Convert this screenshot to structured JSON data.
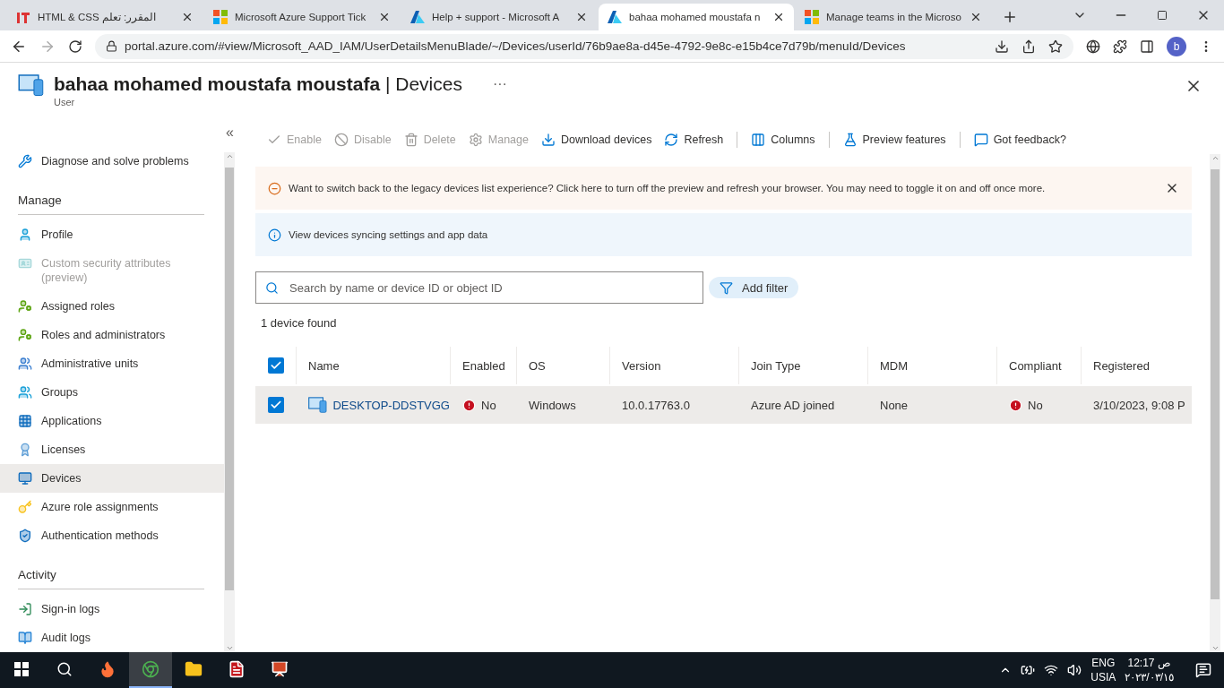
{
  "browser": {
    "tabs": [
      {
        "title": "HTML & CSS المقرر: تعلم",
        "selected": false
      },
      {
        "title": "Microsoft Azure Support Tick",
        "selected": false
      },
      {
        "title": "Help + support - Microsoft A",
        "selected": false
      },
      {
        "title": "bahaa mohamed moustafa n",
        "selected": true
      },
      {
        "title": "Manage teams in the Microso",
        "selected": false
      }
    ],
    "address": "portal.azure.com/#view/Microsoft_AAD_IAM/UserDetailsMenuBlade/~/Devices/userId/76b9ae8a-d45e-4792-9e8c-e15b4ce7d79b/menuId/Devices",
    "profile_initial": "b"
  },
  "blade": {
    "title": "**bahaa mohamed moustafa moustafa** | Devices",
    "subtitle": "User",
    "more": "···"
  },
  "sidebar": {
    "collapse": "«",
    "sections": [
      {
        "items": [
          {
            "label": "Diagnose and solve problems",
            "selected": false,
            "disabled": false
          }
        ]
      },
      {
        "heading": "Manage",
        "items": [
          {
            "label": "Profile",
            "selected": false,
            "disabled": false
          },
          {
            "label": "Custom security attributes (preview)",
            "selected": false,
            "disabled": true
          },
          {
            "label": "Assigned roles",
            "selected": false,
            "disabled": false
          },
          {
            "label": "Roles and administrators",
            "selected": false,
            "disabled": false
          },
          {
            "label": "Administrative units",
            "selected": false,
            "disabled": false
          },
          {
            "label": "Groups",
            "selected": false,
            "disabled": false
          },
          {
            "label": "Applications",
            "selected": false,
            "disabled": false
          },
          {
            "label": "Licenses",
            "selected": false,
            "disabled": false
          },
          {
            "label": "Devices",
            "selected": true,
            "disabled": false
          },
          {
            "label": "Azure role assignments",
            "selected": false,
            "disabled": false
          },
          {
            "label": "Authentication methods",
            "selected": false,
            "disabled": false
          }
        ]
      },
      {
        "heading": "Activity",
        "items": [
          {
            "label": "Sign-in logs",
            "selected": false,
            "disabled": false
          },
          {
            "label": "Audit logs",
            "selected": false,
            "disabled": false
          }
        ]
      }
    ]
  },
  "toolbar": {
    "groups": [
      [
        {
          "label": "Enable",
          "disabled": true
        },
        {
          "label": "Disable",
          "disabled": true
        },
        {
          "label": "Delete",
          "disabled": true
        },
        {
          "label": "Manage",
          "disabled": true
        },
        {
          "label": "Download devices",
          "disabled": false
        },
        {
          "label": "Refresh",
          "disabled": false
        }
      ],
      [
        {
          "label": "Columns",
          "disabled": false
        }
      ],
      [
        {
          "label": "Preview features",
          "disabled": false
        }
      ],
      [
        {
          "label": "Got feedback?",
          "disabled": false
        }
      ]
    ]
  },
  "banners": [
    {
      "kind": "warning",
      "text": "Want to switch back to the legacy devices list experience? Click here to turn off the preview and refresh your browser. You may need to toggle it on and off once more.",
      "dismissible": true
    },
    {
      "kind": "info",
      "text": "View devices syncing settings and app data",
      "dismissible": false
    }
  ],
  "search": {
    "placeholder": "Search by name or device ID or object ID"
  },
  "filter_button": "Add filter",
  "result_count": "1 device found",
  "table": {
    "all_checked": true,
    "columns": [
      "Name",
      "Enabled",
      "OS",
      "Version",
      "Join Type",
      "MDM",
      "Compliant",
      "Registered"
    ],
    "rows": [
      {
        "selected": true,
        "name": "DESKTOP-DDSTVGG",
        "enabled": "No",
        "os": "Windows",
        "version": "10.0.17763.0",
        "join_type": "Azure AD joined",
        "mdm": "None",
        "compliant": "No",
        "registered": "3/10/2023, 9:08 P"
      }
    ]
  },
  "taskbar": {
    "apps": [
      {
        "selected": false
      },
      {
        "selected": true
      },
      {
        "selected": false
      },
      {
        "selected": false
      },
      {
        "selected": false
      }
    ],
    "language": "ENG",
    "region": "USIA",
    "time": "12:17 ص",
    "date": "٢٠٢٣/٠٣/١٥"
  }
}
